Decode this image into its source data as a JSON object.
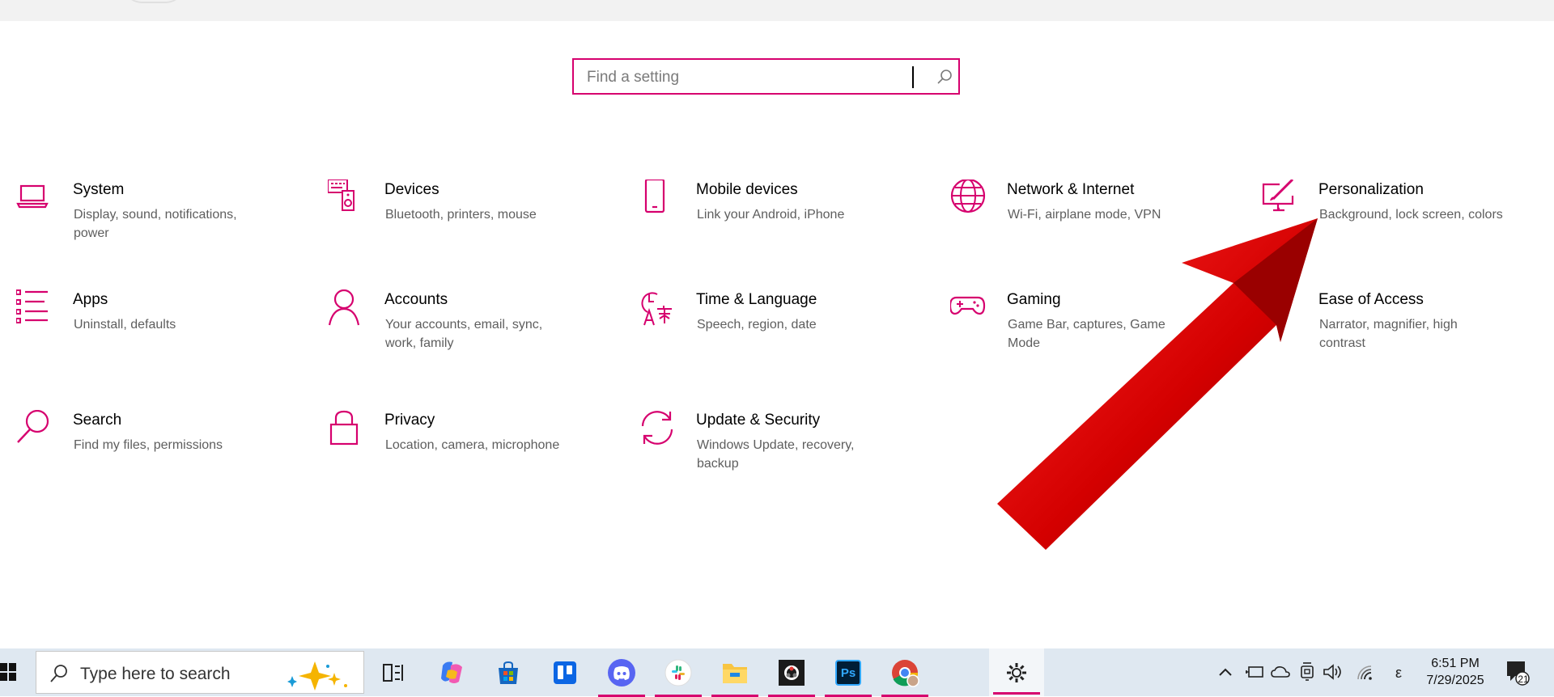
{
  "search": {
    "placeholder": "Find a setting"
  },
  "tiles": [
    {
      "title": "System",
      "desc": "Display, sound, notifications, power"
    },
    {
      "title": "Devices",
      "desc": "Bluetooth, printers, mouse"
    },
    {
      "title": "Mobile devices",
      "desc": "Link your Android, iPhone"
    },
    {
      "title": "Network & Internet",
      "desc": "Wi-Fi, airplane mode, VPN"
    },
    {
      "title": "Personalization",
      "desc": "Background, lock screen, colors"
    },
    {
      "title": "Apps",
      "desc": "Uninstall, defaults"
    },
    {
      "title": "Accounts",
      "desc": "Your accounts, email, sync, work, family"
    },
    {
      "title": "Time & Language",
      "desc": "Speech, region, date"
    },
    {
      "title": "Gaming",
      "desc": "Game Bar, captures, Game Mode"
    },
    {
      "title": "Ease of Access",
      "desc": "Narrator, magnifier, high contrast"
    },
    {
      "title": "Search",
      "desc": "Find my files, permissions"
    },
    {
      "title": "Privacy",
      "desc": "Location, camera, microphone"
    },
    {
      "title": "Update & Security",
      "desc": "Windows Update, recovery, backup"
    }
  ],
  "taskbar": {
    "search_text": "Type here to search",
    "apps": [
      "task-view",
      "copilot",
      "store",
      "trello",
      "discord",
      "slack",
      "file-explorer",
      "obs",
      "photoshop",
      "chrome",
      "settings"
    ],
    "photoshop_label": "Ps",
    "tray_ime": "ε",
    "time": "6:51 PM",
    "date": "7/29/2025",
    "notification_count": "21"
  },
  "colors": {
    "accent": "#d6006e",
    "arrow": "#d40000",
    "taskbar": "#dfe8f1"
  }
}
